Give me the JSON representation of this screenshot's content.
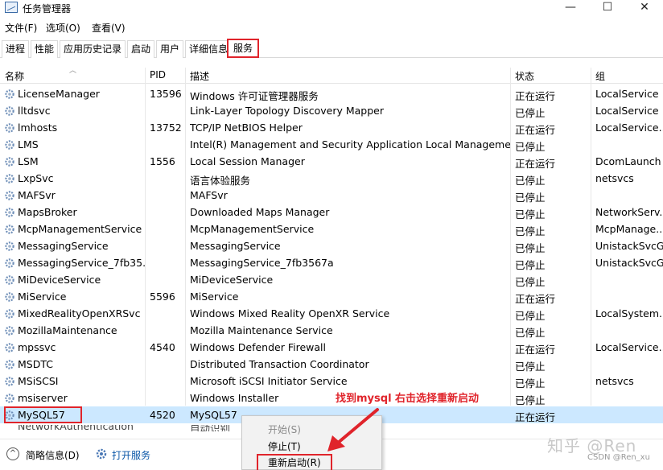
{
  "window": {
    "title": "任务管理器",
    "controls": {
      "minimize": "—",
      "maximize": "☐",
      "close": "✕"
    }
  },
  "menu": [
    "文件(F)",
    "选项(O)",
    "查看(V)"
  ],
  "tabs": [
    {
      "label": "进程",
      "active": false
    },
    {
      "label": "性能",
      "active": false
    },
    {
      "label": "应用历史记录",
      "active": false
    },
    {
      "label": "启动",
      "active": false
    },
    {
      "label": "用户",
      "active": false
    },
    {
      "label": "详细信息",
      "active": false
    },
    {
      "label": "服务",
      "active": true
    }
  ],
  "columns": {
    "name": "名称",
    "pid": "PID",
    "desc": "描述",
    "status": "状态",
    "group": "组"
  },
  "services": [
    {
      "name": "LicenseManager",
      "pid": "13596",
      "desc": "Windows 许可证管理器服务",
      "status": "正在运行",
      "group": "LocalService"
    },
    {
      "name": "lltdsvc",
      "pid": "",
      "desc": "Link-Layer Topology Discovery Mapper",
      "status": "已停止",
      "group": "LocalService"
    },
    {
      "name": "lmhosts",
      "pid": "13752",
      "desc": "TCP/IP NetBIOS Helper",
      "status": "正在运行",
      "group": "LocalService..."
    },
    {
      "name": "LMS",
      "pid": "",
      "desc": "Intel(R) Management and Security Application Local Management...",
      "status": "已停止",
      "group": ""
    },
    {
      "name": "LSM",
      "pid": "1556",
      "desc": "Local Session Manager",
      "status": "正在运行",
      "group": "DcomLaunch"
    },
    {
      "name": "LxpSvc",
      "pid": "",
      "desc": "语言体验服务",
      "status": "已停止",
      "group": "netsvcs"
    },
    {
      "name": "MAFSvr",
      "pid": "",
      "desc": "MAFSvr",
      "status": "已停止",
      "group": ""
    },
    {
      "name": "MapsBroker",
      "pid": "",
      "desc": "Downloaded Maps Manager",
      "status": "已停止",
      "group": "NetworkServ..."
    },
    {
      "name": "McpManagementService",
      "pid": "",
      "desc": "McpManagementService",
      "status": "已停止",
      "group": "McpManage..."
    },
    {
      "name": "MessagingService",
      "pid": "",
      "desc": "MessagingService",
      "status": "已停止",
      "group": "UnistackSvcG..."
    },
    {
      "name": "MessagingService_7fb35...",
      "pid": "",
      "desc": "MessagingService_7fb3567a",
      "status": "已停止",
      "group": "UnistackSvcG..."
    },
    {
      "name": "MiDeviceService",
      "pid": "",
      "desc": "MiDeviceService",
      "status": "已停止",
      "group": ""
    },
    {
      "name": "MiService",
      "pid": "5596",
      "desc": "MiService",
      "status": "正在运行",
      "group": ""
    },
    {
      "name": "MixedRealityOpenXRSvc",
      "pid": "",
      "desc": "Windows Mixed Reality OpenXR Service",
      "status": "已停止",
      "group": "LocalSystem..."
    },
    {
      "name": "MozillaMaintenance",
      "pid": "",
      "desc": "Mozilla Maintenance Service",
      "status": "已停止",
      "group": ""
    },
    {
      "name": "mpssvc",
      "pid": "4540",
      "desc": "Windows Defender Firewall",
      "status": "正在运行",
      "group": "LocalService..."
    },
    {
      "name": "MSDTC",
      "pid": "",
      "desc": "Distributed Transaction Coordinator",
      "status": "已停止",
      "group": ""
    },
    {
      "name": "MSiSCSI",
      "pid": "",
      "desc": "Microsoft iSCSI Initiator Service",
      "status": "已停止",
      "group": "netsvcs"
    },
    {
      "name": "msiserver",
      "pid": "",
      "desc": "Windows Installer",
      "status": "已停止",
      "group": ""
    },
    {
      "name": "MySQL57",
      "pid": "4520",
      "desc": "MySQL57",
      "status": "正在运行",
      "group": "",
      "selected": true
    }
  ],
  "partial_row": {
    "name": "NetworkAuthentication",
    "desc": "自动识别"
  },
  "context_menu": [
    {
      "label": "开始(S)",
      "disabled": true
    },
    {
      "label": "停止(T)",
      "disabled": false
    },
    {
      "label": "重新启动(R)",
      "disabled": false,
      "highlighted": true
    }
  ],
  "annotation": "找到mysql 右击选择重新启动",
  "footer": {
    "summary": "简略信息(D)",
    "open_services": "打开服务"
  },
  "watermark": "知乎 @Ren",
  "credit": "CSDN @Ren_xu",
  "colors": {
    "selection": "#cce8ff",
    "highlight": "#e0242b",
    "link": "#0b57a8"
  },
  "icons": {
    "service": "gear-icon"
  }
}
